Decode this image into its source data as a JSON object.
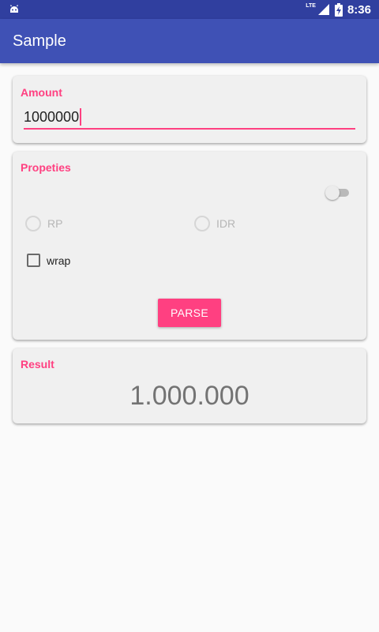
{
  "status_bar": {
    "time": "8:36",
    "network": "LTE",
    "icons": [
      "android-icon",
      "lte-signal-icon",
      "battery-charging-icon"
    ]
  },
  "app_bar": {
    "title": "Sample"
  },
  "amount_card": {
    "label": "Amount",
    "value": "1000000"
  },
  "properties_card": {
    "label": "Propeties",
    "switch_on": false,
    "radios": [
      {
        "label": "RP",
        "checked": false,
        "enabled": false
      },
      {
        "label": "IDR",
        "checked": false,
        "enabled": false
      }
    ],
    "checkbox": {
      "label": "wrap",
      "checked": false
    },
    "parse_label": "PARSE"
  },
  "result_card": {
    "label": "Result",
    "value": "1.000.000"
  },
  "colors": {
    "primary": "#3f51b5",
    "primary_dark": "#303f9f",
    "accent": "#ff4081"
  }
}
